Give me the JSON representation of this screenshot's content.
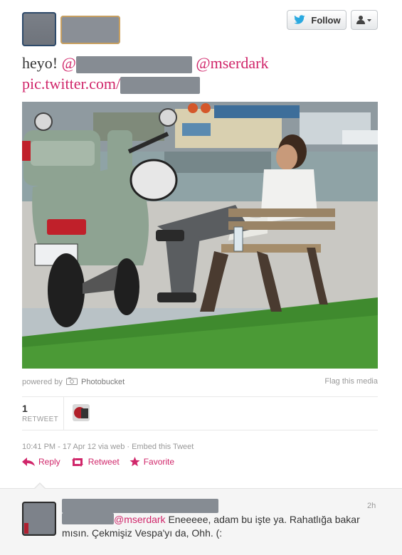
{
  "header": {
    "follow_label": "Follow"
  },
  "tweet": {
    "greeting": "heyo!",
    "at_symbol": "@",
    "mention": "@mserdark",
    "link_prefix": "pic.twitter.com/"
  },
  "media": {
    "powered_by": "powered by",
    "provider": "Photobucket",
    "flag_label": "Flag this media"
  },
  "stats": {
    "retweet_count": "1",
    "retweet_label": "RETWEET"
  },
  "meta": {
    "timestamp": "10:41 PM - 17 Apr 12 via web · Embed this Tweet"
  },
  "actions": {
    "reply": "Reply",
    "retweet": "Retweet",
    "favorite": "Favorite"
  },
  "reply_tweet": {
    "time": "2h",
    "mention": "@mserdark",
    "text": " Eneeeee, adam bu işte ya. Rahatlığa bakar mısın. Çekmişiz Vespa'yı da, Ohh. (:"
  },
  "colors": {
    "accent": "#d0266a",
    "twitter_blue": "#2aa9e0"
  }
}
